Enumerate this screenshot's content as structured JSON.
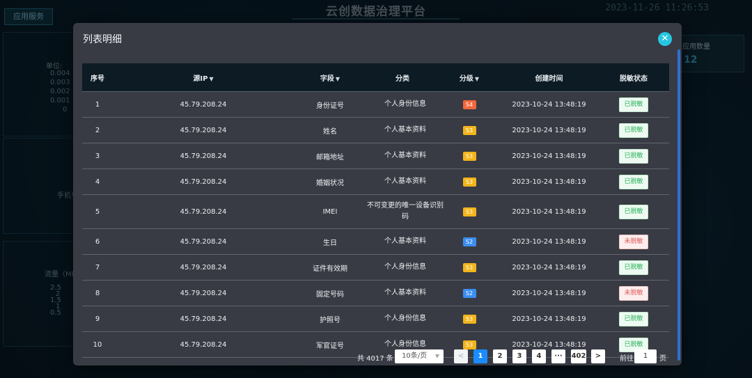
{
  "background": {
    "app_title": "云创数据治理平台",
    "tab_label": "应用服务",
    "clock": "2023-11-26 11:26:53",
    "unit_label": "单位:",
    "y_ticks": [
      "0.004",
      "0.003",
      "0.002",
      "0.001",
      "0"
    ],
    "phone_label": "手机号",
    "flow_label": "流量（MB",
    "flow_ticks": [
      "2.5",
      "2",
      "1.5",
      "1",
      "0.5"
    ],
    "right_card_label": "应用数量",
    "right_card_value": "12"
  },
  "modal": {
    "title": "列表明细",
    "close_icon": "close-icon",
    "columns": [
      "序号",
      "源IP",
      "字段",
      "分类",
      "分级",
      "创建时间",
      "脱敏状态"
    ],
    "rows": [
      {
        "no": "1",
        "ip": "45.79.208.24",
        "field": "身份证号",
        "category": "个人身份信息",
        "level": "S4",
        "level_color": "#f2683c",
        "time": "2023-10-24 13:48:19",
        "status": "已脱敏",
        "status_type": "ok"
      },
      {
        "no": "2",
        "ip": "45.79.208.24",
        "field": "姓名",
        "category": "个人基本资料",
        "level": "S3",
        "level_color": "#f2b51c",
        "time": "2023-10-24 13:48:19",
        "status": "已脱敏",
        "status_type": "ok"
      },
      {
        "no": "3",
        "ip": "45.79.208.24",
        "field": "邮箱地址",
        "category": "个人基本资料",
        "level": "S3",
        "level_color": "#f2b51c",
        "time": "2023-10-24 13:48:19",
        "status": "已脱敏",
        "status_type": "ok"
      },
      {
        "no": "4",
        "ip": "45.79.208.24",
        "field": "婚姻状况",
        "category": "个人基本资料",
        "level": "S3",
        "level_color": "#f2b51c",
        "time": "2023-10-24 13:48:19",
        "status": "已脱敏",
        "status_type": "ok"
      },
      {
        "no": "5",
        "ip": "45.79.208.24",
        "field": "IMEI",
        "category": "不可变更的唯一设备识别码",
        "level": "S3",
        "level_color": "#f2b51c",
        "time": "2023-10-24 13:48:19",
        "status": "已脱敏",
        "status_type": "ok"
      },
      {
        "no": "6",
        "ip": "45.79.208.24",
        "field": "生日",
        "category": "个人基本资料",
        "level": "S2",
        "level_color": "#3b8ef0",
        "time": "2023-10-24 13:48:19",
        "status": "未脱敏",
        "status_type": "no"
      },
      {
        "no": "7",
        "ip": "45.79.208.24",
        "field": "证件有效期",
        "category": "个人身份信息",
        "level": "S3",
        "level_color": "#f2b51c",
        "time": "2023-10-24 13:48:19",
        "status": "已脱敏",
        "status_type": "ok"
      },
      {
        "no": "8",
        "ip": "45.79.208.24",
        "field": "固定号码",
        "category": "个人基本资料",
        "level": "S2",
        "level_color": "#3b8ef0",
        "time": "2023-10-24 13:48:19",
        "status": "未脱敏",
        "status_type": "no"
      },
      {
        "no": "9",
        "ip": "45.79.208.24",
        "field": "护照号",
        "category": "个人身份信息",
        "level": "S3",
        "level_color": "#f2b51c",
        "time": "2023-10-24 13:48:19",
        "status": "已脱敏",
        "status_type": "ok"
      },
      {
        "no": "10",
        "ip": "45.79.208.24",
        "field": "军官证号",
        "category": "个人身份信息",
        "level": "S3",
        "level_color": "#f2b51c",
        "time": "2023-10-24 13:48:19",
        "status": "已脱敏",
        "status_type": "ok"
      }
    ],
    "pagination": {
      "total": "共 4017 条",
      "page_size": "10条/页",
      "pages": [
        "1",
        "2",
        "3",
        "4",
        "···",
        "402"
      ],
      "current": "1",
      "goto_prefix": "前往",
      "goto_value": "1",
      "goto_suffix": "页"
    }
  }
}
